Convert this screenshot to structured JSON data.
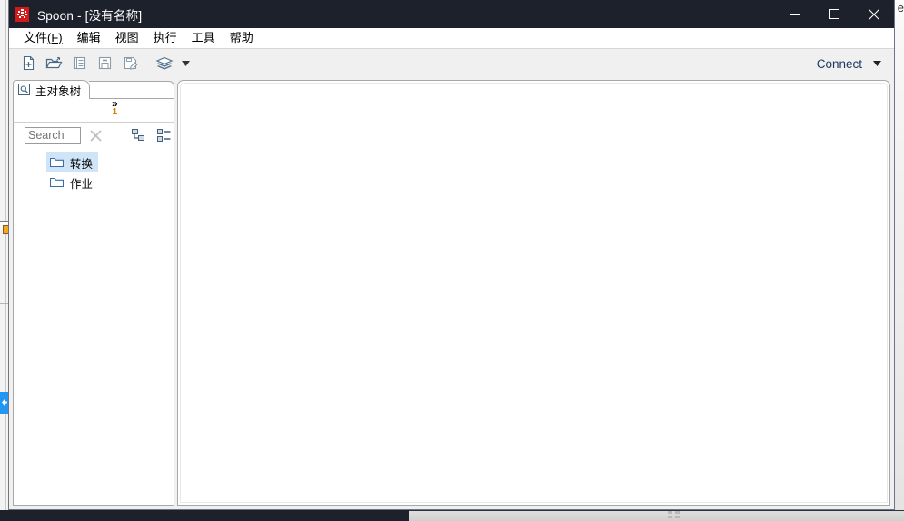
{
  "window": {
    "app_icon_name": "spoon-app-icon",
    "title": "Spoon - [没有名称]",
    "minimize_label": "–",
    "maximize_label": "□",
    "close_label": "✕"
  },
  "menubar": {
    "items": [
      {
        "label": "文件",
        "mnemonic": "(F)",
        "name": "menu-file"
      },
      {
        "label": "编辑",
        "mnemonic": "",
        "name": "menu-edit"
      },
      {
        "label": "视图",
        "mnemonic": "",
        "name": "menu-view"
      },
      {
        "label": "执行",
        "mnemonic": "",
        "name": "menu-run"
      },
      {
        "label": "工具",
        "mnemonic": "",
        "name": "menu-tools"
      },
      {
        "label": "帮助",
        "mnemonic": "",
        "name": "menu-help"
      }
    ]
  },
  "toolbar": {
    "buttons": [
      {
        "name": "new-file-button",
        "icon": "new-file-icon"
      },
      {
        "name": "open-file-button",
        "icon": "open-folder-icon"
      },
      {
        "name": "explore-repository-button",
        "icon": "document-list-icon"
      },
      {
        "name": "save-button",
        "icon": "save-icon"
      },
      {
        "name": "save-as-button",
        "icon": "save-as-icon"
      },
      {
        "name": "perspective-button",
        "icon": "layers-icon"
      }
    ],
    "perspective_caret": "▾",
    "connect_label": "Connect",
    "connect_caret": "▾"
  },
  "left_panel": {
    "tab": {
      "label": "主对象树",
      "icon": "tree-view-icon"
    },
    "overflow": {
      "chevron": "»",
      "count": "1"
    },
    "search": {
      "placeholder": "Search",
      "value": "",
      "clear_icon": "clear-x-icon",
      "expand_icon": "expand-tree-icon",
      "list_icon": "list-view-icon"
    },
    "tree": {
      "nodes": [
        {
          "label": "转换",
          "icon": "folder-icon",
          "selected": true
        },
        {
          "label": "作业",
          "icon": "folder-icon",
          "selected": false
        }
      ]
    }
  },
  "canvas": {
    "content": ""
  },
  "background": {
    "right_edge_char": "e"
  },
  "colors": {
    "titlebar": "#1c212b",
    "accent_connect": "#1f3864",
    "selection": "#cfe4f7",
    "app_icon": "#d21b18",
    "badge": "#e07b00"
  }
}
